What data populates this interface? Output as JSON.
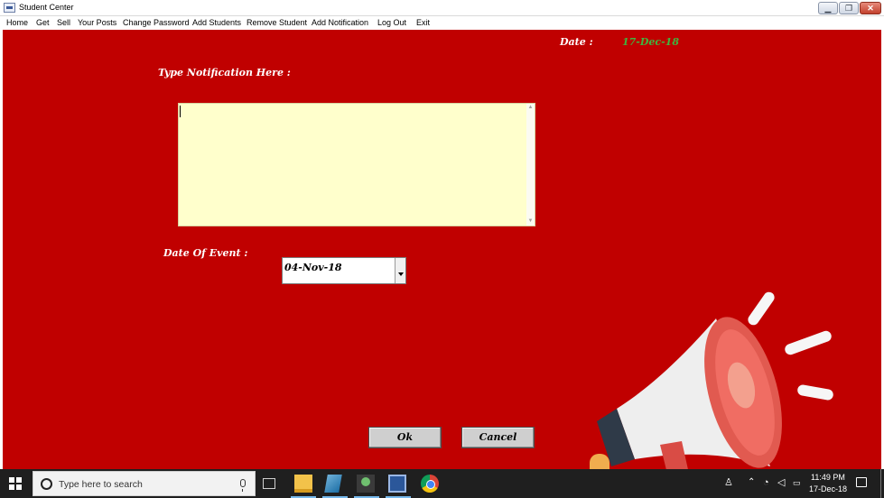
{
  "window": {
    "title": "Student Center",
    "minimize_symbol": "▁",
    "maximize_symbol": "❐",
    "close_symbol": "✕"
  },
  "menu": {
    "items": [
      "Home",
      "Get",
      "Sell",
      "Your Posts",
      "Change Password",
      "Add Students",
      "Remove Student",
      "Add Notification",
      "Log Out",
      "Exit"
    ]
  },
  "form": {
    "date_label": "Date :",
    "date_value": "17-Dec-18",
    "notification_label": "Type Notification Here :",
    "notification_value": "",
    "event_date_label": "Date Of Event :",
    "event_date_value": "04-Nov-18",
    "ok_label": "Ok",
    "cancel_label": "Cancel"
  },
  "taskbar": {
    "search_placeholder": "Type here to search",
    "time": "11:49 PM",
    "date": "17-Dec-18",
    "pinned_apps": [
      "task-view-icon",
      "file-explorer-icon",
      "photos-icon",
      "people-app-icon",
      "word-icon",
      "chrome-icon"
    ]
  },
  "colors": {
    "form_background": "#c00000",
    "date_value_color": "#3fb53f",
    "textarea_background": "#ffffcc",
    "taskbar_background": "#1f1f1f"
  },
  "icons": {
    "illustration": "megaphone-icon"
  }
}
